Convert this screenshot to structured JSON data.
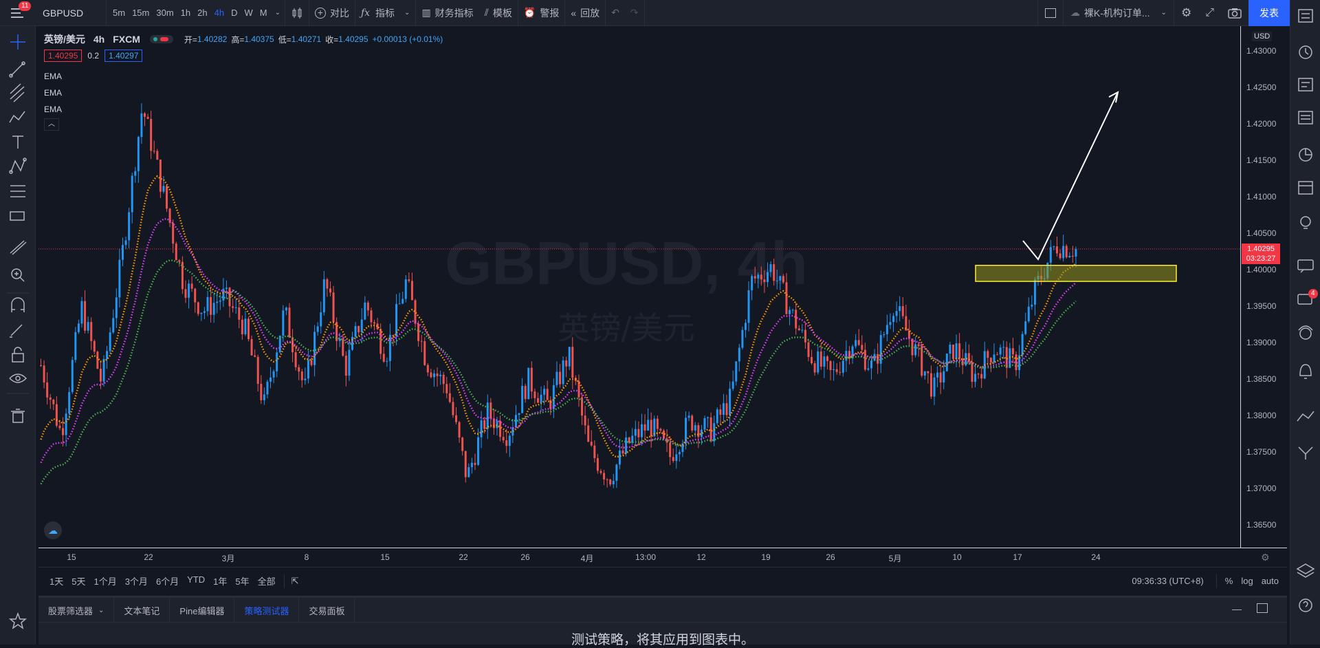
{
  "topbar": {
    "notifications": "11",
    "symbol": "GBPUSD",
    "intervals": [
      "5m",
      "15m",
      "30m",
      "1h",
      "2h",
      "4h",
      "D",
      "W",
      "M"
    ],
    "active_interval": "4h",
    "compare": "对比",
    "indicators": "指标",
    "financials": "财务指标",
    "templates": "模板",
    "alerts": "警报",
    "replay": "回放",
    "layout_name": "裸K-机构订单...",
    "publish": "发表"
  },
  "legend": {
    "title": "英镑/美元",
    "interval": "4h",
    "exchange": "FXCM",
    "open_label": "开=",
    "open": "1.40282",
    "high_label": "高=",
    "high": "1.40375",
    "low_label": "低=",
    "low": "1.40271",
    "close_label": "收=",
    "close": "1.40295",
    "change": "+0.00013 (+0.01%)",
    "bid": "1.40295",
    "spread": "0.2",
    "ask": "1.40297",
    "indicators": [
      "EMA",
      "EMA",
      "EMA"
    ]
  },
  "watermark": {
    "symbol": "GBPUSD, 4h",
    "name": "英镑/美元"
  },
  "price_scale": {
    "currency": "USD",
    "labels": [
      "1.43000",
      "1.42500",
      "1.42000",
      "1.41500",
      "1.41000",
      "1.40500",
      "1.40000",
      "1.39500",
      "1.39000",
      "1.38500",
      "1.38000",
      "1.37500",
      "1.37000",
      "1.36500"
    ],
    "last_price": "1.40295",
    "countdown": "03:23:27"
  },
  "time_scale": {
    "labels": [
      "15",
      "22",
      "3月",
      "8",
      "15",
      "22",
      "26",
      "4月",
      "13:00",
      "12",
      "19",
      "26",
      "5月",
      "10",
      "17",
      "24"
    ]
  },
  "range_bar": {
    "ranges": [
      "1天",
      "5天",
      "1个月",
      "3个月",
      "6个月",
      "YTD",
      "1年",
      "5年",
      "全部"
    ],
    "clock": "09:36:33 (UTC+8)",
    "percent": "%",
    "log": "log",
    "auto": "auto"
  },
  "bottom_panel": {
    "tabs": [
      "股票筛选器",
      "文本笔记",
      "Pine编辑器",
      "策略测试器",
      "交易面板"
    ],
    "active_tab": "策略测试器",
    "message": "测试策略，将其应用到图表中。"
  },
  "right_toolbar": {
    "chat_badge": "4"
  },
  "chart_data": {
    "type": "candlestick",
    "symbol": "GBPUSD",
    "interval": "4h",
    "ylim": [
      1.362,
      1.4335
    ],
    "series_ema": [
      "orange",
      "magenta",
      "green"
    ],
    "last_price": 1.40295,
    "zone": {
      "low": 1.3985,
      "high": 1.4007
    },
    "colors": {
      "up": "#2196f3",
      "down": "#ef5350",
      "ema1": "#ff9800",
      "ema2": "#e040fb",
      "ema3": "#4caf50",
      "zone": "#ffeb3b"
    },
    "path": [
      1.387,
      1.3775,
      1.395,
      1.3845,
      1.402,
      1.4225,
      1.411,
      1.3985,
      1.3945,
      1.3965,
      1.3925,
      1.3815,
      1.3945,
      1.3835,
      1.3985,
      1.3865,
      1.3955,
      1.3885,
      1.3985,
      1.3875,
      1.384,
      1.3715,
      1.3805,
      1.3775,
      1.385,
      1.3815,
      1.3885,
      1.3755,
      1.3715,
      1.3765,
      1.379,
      1.3745,
      1.3795,
      1.378,
      1.3825,
      1.3985,
      1.4005,
      1.394,
      1.388,
      1.3855,
      1.3905,
      1.3865,
      1.3955,
      1.3895,
      1.3835,
      1.3895,
      1.3855,
      1.3895,
      1.387,
      1.3975,
      1.4035,
      1.4029
    ]
  }
}
